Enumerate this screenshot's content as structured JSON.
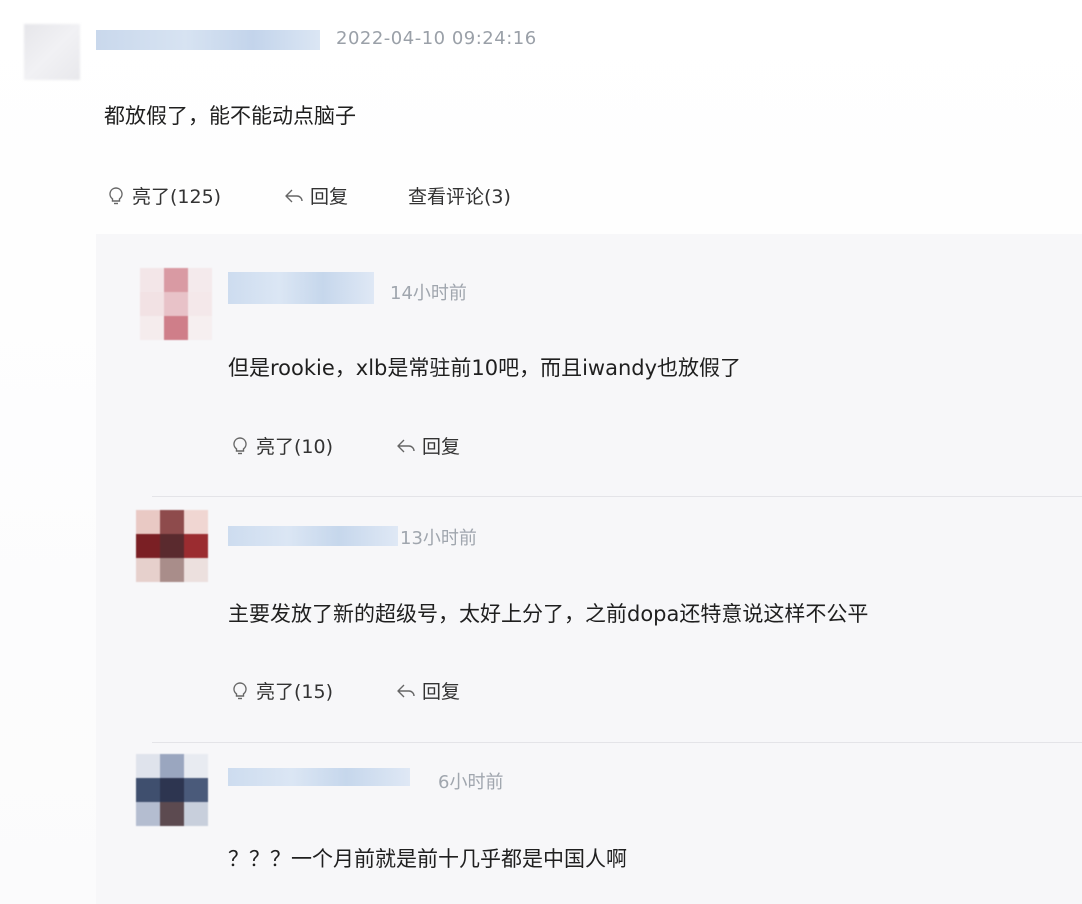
{
  "main_comment": {
    "timestamp": "2022-04-10 09:24:16",
    "text": "都放假了，能不能动点脑子",
    "like_label": "亮了(125)",
    "reply_label": "回复",
    "view_replies_label": "查看评论(3)"
  },
  "replies": [
    {
      "time": "14小时前",
      "text": "但是rookie，xlb是常驻前10吧，而且iwandy也放假了",
      "like_label": "亮了(10)",
      "reply_label": "回复"
    },
    {
      "time": "13小时前",
      "text": "主要发放了新的超级号，太好上分了，之前dopa还特意说这样不公平",
      "like_label": "亮了(15)",
      "reply_label": "回复"
    },
    {
      "time": "6小时前",
      "text": "？？？一个月前就是前十几乎都是中国人啊"
    }
  ],
  "icons": {
    "like": "lightbulb-icon",
    "reply": "reply-arrow-icon"
  },
  "colors": {
    "timestamp": "#9aa0a8",
    "reply_panel_bg": "#f7f7f9",
    "name_blur": "#c9d8ec"
  }
}
